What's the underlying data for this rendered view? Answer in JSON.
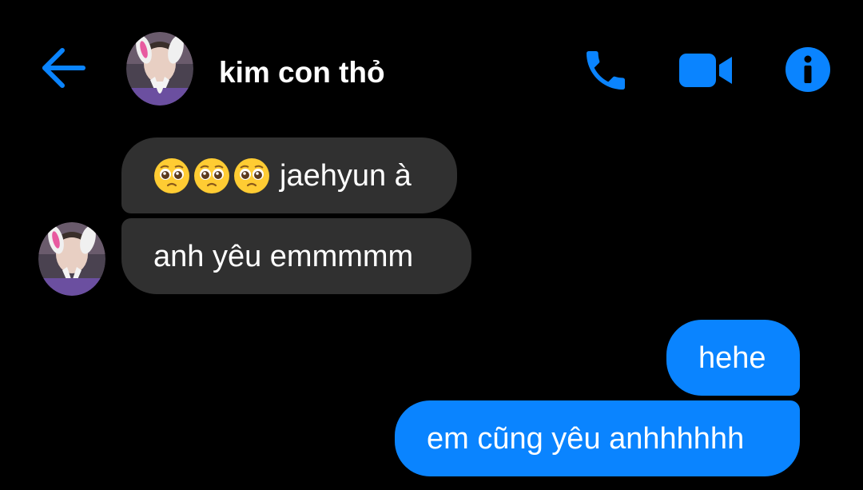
{
  "header": {
    "title": "kim con thỏ",
    "back_icon": "arrow-left-icon",
    "call_icon": "phone-icon",
    "video_icon": "video-camera-icon",
    "info_icon": "info-icon",
    "avatar_icon": "profile-avatar"
  },
  "messages": [
    {
      "direction": "received",
      "emoji": [
        "pleading-face",
        "pleading-face",
        "pleading-face"
      ],
      "text": "jaehyun à"
    },
    {
      "direction": "received",
      "text": "anh yêu emmmmm"
    },
    {
      "direction": "sent",
      "text": "hehe"
    },
    {
      "direction": "sent",
      "text": "em cũng yêu anhhhhhh"
    }
  ],
  "colors": {
    "background": "#000000",
    "accent": "#0A84FF",
    "received_bubble": "#303030",
    "text": "#FFFFFF"
  }
}
